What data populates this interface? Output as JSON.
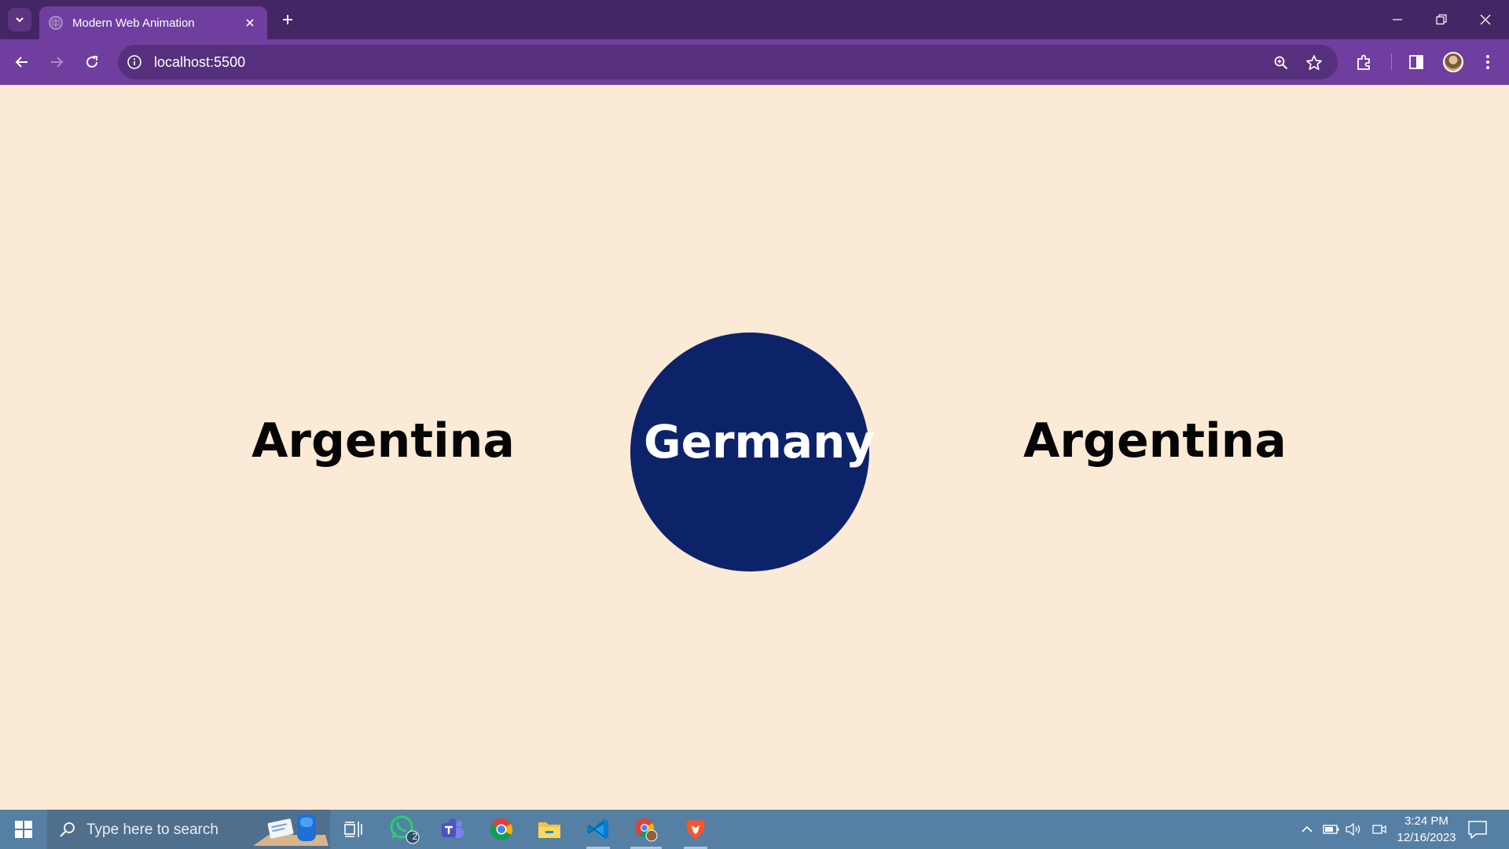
{
  "browser": {
    "tab_title": "Modern Web Animation",
    "url": "localhost:5500"
  },
  "page": {
    "left_word": "Argentina",
    "center_word": "Germany",
    "right_word": "Argentina",
    "circle_color": "#0d2369",
    "background_color": "#fbead6"
  },
  "taskbar": {
    "search_placeholder": "Type here to search",
    "whatsapp_badge": "2",
    "time": "3:24 PM",
    "date": "12/16/2023",
    "apps": [
      "task-view-icon",
      "whatsapp-icon",
      "teams-icon",
      "chrome-icon",
      "file-explorer-icon",
      "vscode-icon",
      "chrome-profile-icon",
      "brave-icon"
    ]
  },
  "colors": {
    "titlebar": "#452664",
    "toolbar": "#6f3e9e",
    "taskbar": "#567fa4"
  }
}
